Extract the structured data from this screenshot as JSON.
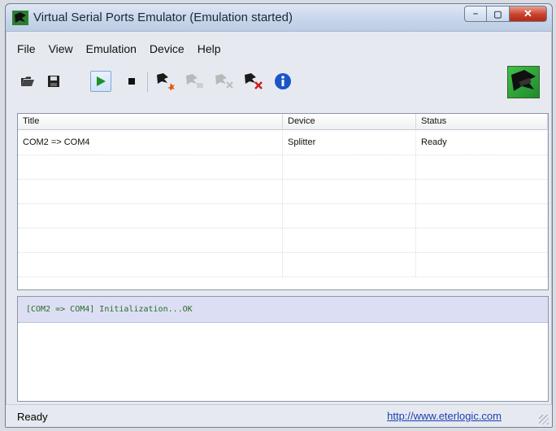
{
  "window": {
    "title": "Virtual Serial Ports Emulator (Emulation started)",
    "minimize_label": "–",
    "maximize_label": "▢",
    "close_label": "✕"
  },
  "menu": [
    "File",
    "View",
    "Emulation",
    "Device",
    "Help"
  ],
  "toolbar": {
    "icons": [
      "open-icon",
      "save-icon",
      "start-icon",
      "stop-icon",
      "new-device-icon",
      "edit-device-icon",
      "disable-device-icon",
      "delete-device-icon",
      "info-icon"
    ],
    "active": "start-icon"
  },
  "table": {
    "columns": [
      "Title",
      "Device",
      "Status"
    ],
    "rows": [
      {
        "title": "COM2 => COM4",
        "device": "Splitter",
        "status": "Ready"
      }
    ]
  },
  "log": {
    "lines": [
      "[COM2 => COM4] Initialization...OK"
    ]
  },
  "statusbar": {
    "text": "Ready",
    "link": "http://www.eterlogic.com"
  },
  "colors": {
    "log_text": "#2a6a2a",
    "log_bg": "#dcdff4",
    "link": "#1a3fb5",
    "close_btn": "#c9402b"
  }
}
